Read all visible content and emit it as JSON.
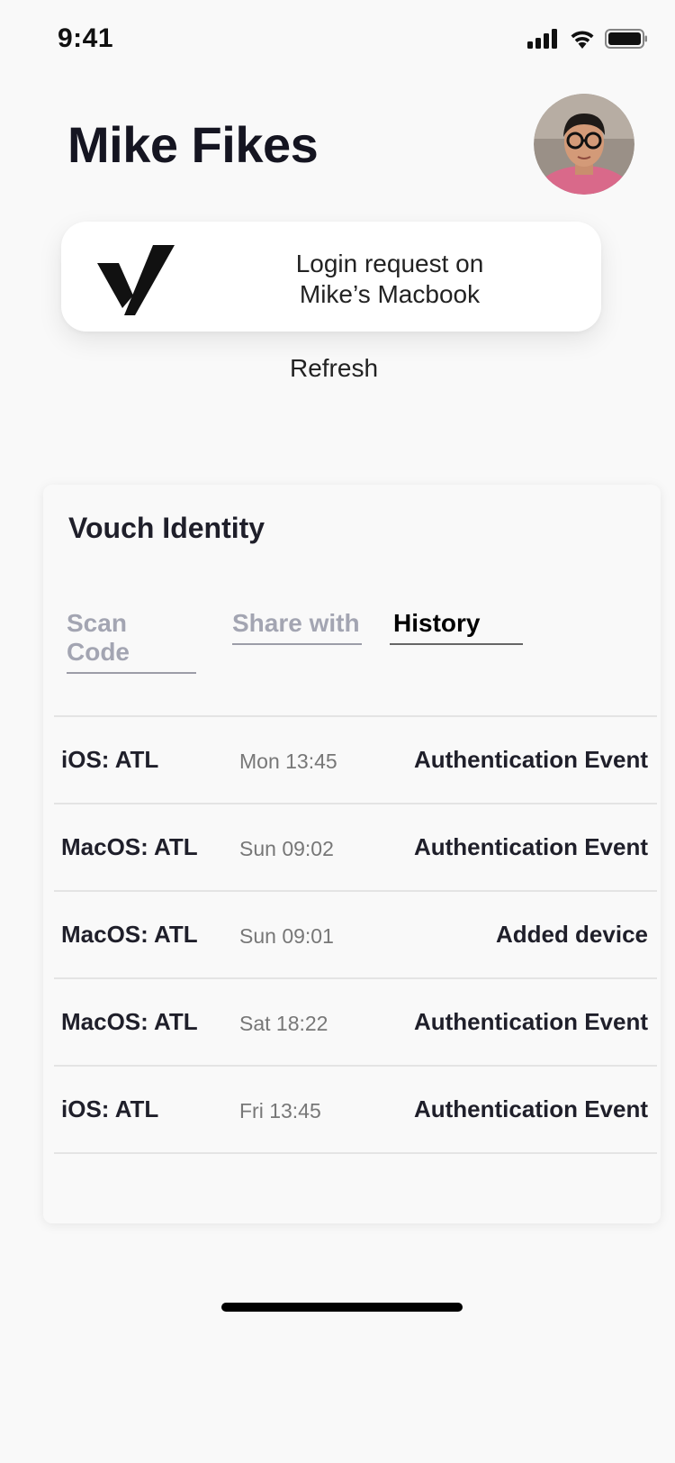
{
  "status_bar": {
    "time": "9:41"
  },
  "header": {
    "user_name": "Mike Fikes"
  },
  "login_request": {
    "line1": "Login request on",
    "line2": "Mike’s Macbook"
  },
  "refresh_label": "Refresh",
  "identity": {
    "title": "Vouch Identity",
    "tabs": [
      {
        "label": "Scan Code",
        "active": false
      },
      {
        "label": "Share with",
        "active": false
      },
      {
        "label": "History",
        "active": true
      }
    ],
    "history": [
      {
        "device": "iOS: ATL",
        "time": "Mon 13:45",
        "event": "Authentication Event"
      },
      {
        "device": "MacOS: ATL",
        "time": "Sun 09:02",
        "event": "Authentication Event"
      },
      {
        "device": "MacOS: ATL",
        "time": "Sun 09:01",
        "event": "Added device"
      },
      {
        "device": "MacOS: ATL",
        "time": "Sat 18:22",
        "event": "Authentication Event"
      },
      {
        "device": "iOS: ATL",
        "time": "Fri 13:45",
        "event": "Authentication Event"
      }
    ]
  }
}
